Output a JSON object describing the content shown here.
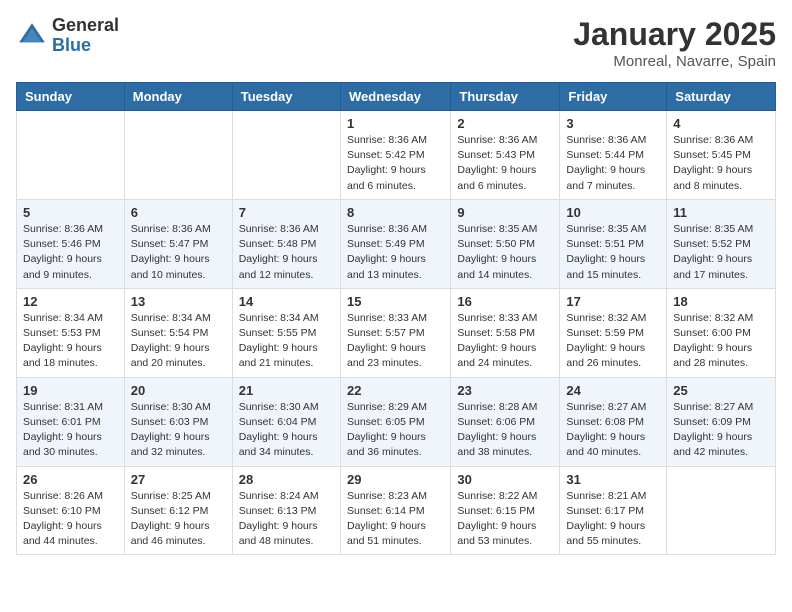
{
  "logo": {
    "general": "General",
    "blue": "Blue"
  },
  "title": "January 2025",
  "location": "Monreal, Navarre, Spain",
  "days_of_week": [
    "Sunday",
    "Monday",
    "Tuesday",
    "Wednesday",
    "Thursday",
    "Friday",
    "Saturday"
  ],
  "weeks": [
    [
      {
        "num": "",
        "info": ""
      },
      {
        "num": "",
        "info": ""
      },
      {
        "num": "",
        "info": ""
      },
      {
        "num": "1",
        "info": "Sunrise: 8:36 AM\nSunset: 5:42 PM\nDaylight: 9 hours and 6 minutes."
      },
      {
        "num": "2",
        "info": "Sunrise: 8:36 AM\nSunset: 5:43 PM\nDaylight: 9 hours and 6 minutes."
      },
      {
        "num": "3",
        "info": "Sunrise: 8:36 AM\nSunset: 5:44 PM\nDaylight: 9 hours and 7 minutes."
      },
      {
        "num": "4",
        "info": "Sunrise: 8:36 AM\nSunset: 5:45 PM\nDaylight: 9 hours and 8 minutes."
      }
    ],
    [
      {
        "num": "5",
        "info": "Sunrise: 8:36 AM\nSunset: 5:46 PM\nDaylight: 9 hours and 9 minutes."
      },
      {
        "num": "6",
        "info": "Sunrise: 8:36 AM\nSunset: 5:47 PM\nDaylight: 9 hours and 10 minutes."
      },
      {
        "num": "7",
        "info": "Sunrise: 8:36 AM\nSunset: 5:48 PM\nDaylight: 9 hours and 12 minutes."
      },
      {
        "num": "8",
        "info": "Sunrise: 8:36 AM\nSunset: 5:49 PM\nDaylight: 9 hours and 13 minutes."
      },
      {
        "num": "9",
        "info": "Sunrise: 8:35 AM\nSunset: 5:50 PM\nDaylight: 9 hours and 14 minutes."
      },
      {
        "num": "10",
        "info": "Sunrise: 8:35 AM\nSunset: 5:51 PM\nDaylight: 9 hours and 15 minutes."
      },
      {
        "num": "11",
        "info": "Sunrise: 8:35 AM\nSunset: 5:52 PM\nDaylight: 9 hours and 17 minutes."
      }
    ],
    [
      {
        "num": "12",
        "info": "Sunrise: 8:34 AM\nSunset: 5:53 PM\nDaylight: 9 hours and 18 minutes."
      },
      {
        "num": "13",
        "info": "Sunrise: 8:34 AM\nSunset: 5:54 PM\nDaylight: 9 hours and 20 minutes."
      },
      {
        "num": "14",
        "info": "Sunrise: 8:34 AM\nSunset: 5:55 PM\nDaylight: 9 hours and 21 minutes."
      },
      {
        "num": "15",
        "info": "Sunrise: 8:33 AM\nSunset: 5:57 PM\nDaylight: 9 hours and 23 minutes."
      },
      {
        "num": "16",
        "info": "Sunrise: 8:33 AM\nSunset: 5:58 PM\nDaylight: 9 hours and 24 minutes."
      },
      {
        "num": "17",
        "info": "Sunrise: 8:32 AM\nSunset: 5:59 PM\nDaylight: 9 hours and 26 minutes."
      },
      {
        "num": "18",
        "info": "Sunrise: 8:32 AM\nSunset: 6:00 PM\nDaylight: 9 hours and 28 minutes."
      }
    ],
    [
      {
        "num": "19",
        "info": "Sunrise: 8:31 AM\nSunset: 6:01 PM\nDaylight: 9 hours and 30 minutes."
      },
      {
        "num": "20",
        "info": "Sunrise: 8:30 AM\nSunset: 6:03 PM\nDaylight: 9 hours and 32 minutes."
      },
      {
        "num": "21",
        "info": "Sunrise: 8:30 AM\nSunset: 6:04 PM\nDaylight: 9 hours and 34 minutes."
      },
      {
        "num": "22",
        "info": "Sunrise: 8:29 AM\nSunset: 6:05 PM\nDaylight: 9 hours and 36 minutes."
      },
      {
        "num": "23",
        "info": "Sunrise: 8:28 AM\nSunset: 6:06 PM\nDaylight: 9 hours and 38 minutes."
      },
      {
        "num": "24",
        "info": "Sunrise: 8:27 AM\nSunset: 6:08 PM\nDaylight: 9 hours and 40 minutes."
      },
      {
        "num": "25",
        "info": "Sunrise: 8:27 AM\nSunset: 6:09 PM\nDaylight: 9 hours and 42 minutes."
      }
    ],
    [
      {
        "num": "26",
        "info": "Sunrise: 8:26 AM\nSunset: 6:10 PM\nDaylight: 9 hours and 44 minutes."
      },
      {
        "num": "27",
        "info": "Sunrise: 8:25 AM\nSunset: 6:12 PM\nDaylight: 9 hours and 46 minutes."
      },
      {
        "num": "28",
        "info": "Sunrise: 8:24 AM\nSunset: 6:13 PM\nDaylight: 9 hours and 48 minutes."
      },
      {
        "num": "29",
        "info": "Sunrise: 8:23 AM\nSunset: 6:14 PM\nDaylight: 9 hours and 51 minutes."
      },
      {
        "num": "30",
        "info": "Sunrise: 8:22 AM\nSunset: 6:15 PM\nDaylight: 9 hours and 53 minutes."
      },
      {
        "num": "31",
        "info": "Sunrise: 8:21 AM\nSunset: 6:17 PM\nDaylight: 9 hours and 55 minutes."
      },
      {
        "num": "",
        "info": ""
      }
    ]
  ]
}
